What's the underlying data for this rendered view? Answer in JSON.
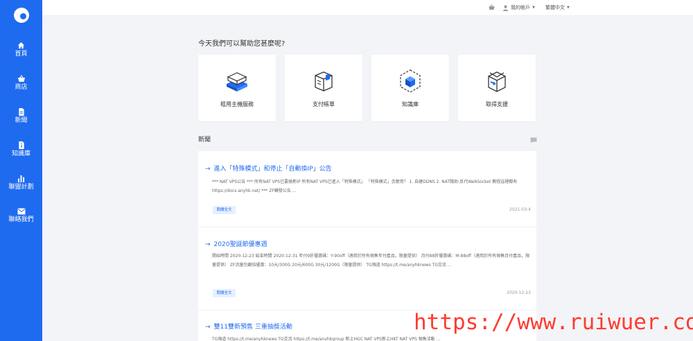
{
  "sidebar": {
    "items": [
      {
        "label": "首頁",
        "icon": "home-icon"
      },
      {
        "label": "商店",
        "icon": "basket-icon"
      },
      {
        "label": "新聞",
        "icon": "document-icon"
      },
      {
        "label": "知識庫",
        "icon": "info-document-icon"
      },
      {
        "label": "聯盟計劃",
        "icon": "bar-chart-icon"
      },
      {
        "label": "聯絡我們",
        "icon": "envelope-icon"
      }
    ]
  },
  "topbar": {
    "account": "我的帳戶",
    "language": "繁體中文"
  },
  "main": {
    "headline": "今天我們可以幫助您甚麼呢?",
    "tiles": [
      {
        "label": "租用主機服務",
        "icon": "server-box-icon"
      },
      {
        "label": "支付帳單",
        "icon": "payment-box-icon"
      },
      {
        "label": "知識庫",
        "icon": "knowledge-cube-icon"
      },
      {
        "label": "取得支援",
        "icon": "support-box-icon"
      }
    ]
  },
  "news": {
    "title": "新聞",
    "items": [
      {
        "title": "進入「特殊模式」和停止「自動換IP」公告",
        "excerpt": "*** NAT VPS公告 ***  所有NAT VPS已要換新IP 所有NAT VPS已進入「特殊模式」 「特殊模式」怎麼用？ 1. 自建DDNS 2. NAT隧助-反代WebSocket 教程這裡都有 https://docs.anyhk.net/   *** ZF轉發公告 ...",
        "read_more": "閱讀全文",
        "date": "2021-03-4"
      },
      {
        "title": "2020聖誕節優惠週",
        "excerpt": "開始時間 2020-12-23 結束時間 2020-12-31   年付9折優惠碼：Y-90off（適用於所有現售年付產品，限量提供） 月付88折優惠碼：M-88off（適用於所有現售月付產品，限量提供） ZF流量包翻倍優惠：10元/300G 20元/600G 30元/1200G（限量提供）   TG頻道 https://t.me/anyhknews TG交流 ...",
        "read_more": "閱讀全文",
        "date": "2020-12-23"
      },
      {
        "title": "雙11雙新預售 三重抽獎活動",
        "excerpt": "TG頻道 https://t.me/anyhknews TG交流 https://t.me/anyhkgroup 新上HGC NAT VPS新上HKT NAT VPS 預售活動 ...",
        "read_more": "",
        "date": ""
      }
    ]
  },
  "watermark": "https://www.ruiwuer.com"
}
